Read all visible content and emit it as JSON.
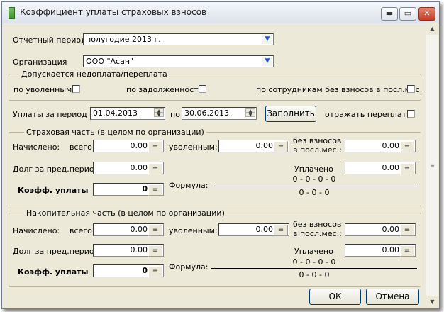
{
  "window": {
    "title": "Коэффициент уплаты страховых взносов",
    "buttons": {
      "minimize": "▬",
      "maximize": "▭",
      "close": "✕"
    }
  },
  "period": {
    "label": "Отчетный период",
    "value": "полугодие 2013 г."
  },
  "org": {
    "label": "Организация",
    "value": "ООО \"Асан\""
  },
  "allowed": {
    "title": "Допускается недоплата/переплата",
    "dismissed": "по уволенным",
    "debt": "по задолженности",
    "no_contrib": "по сотрудникам без взносов в посл.мес."
  },
  "payments": {
    "label": "Уплаты за период с",
    "from": "01.04.2013",
    "to_label": "по",
    "to": "30.06.2013",
    "fill_button": "Заполнить",
    "overpay_label": "отражать переплату"
  },
  "insurance": {
    "title": "Страховая часть (в целом по организации)",
    "accrued_label": "Начислено:",
    "total_label": "всего:",
    "total": "0.00",
    "dismissed_label": "уволенным:",
    "dismissed": "0.00",
    "no_contrib_label_1": "без взносов",
    "no_contrib_label_2": "в посл.мес.:",
    "no_contrib": "0.00",
    "debt_label": "Долг за пред.период:",
    "debt": "0.00",
    "paid_label": "Уплачено",
    "paid": "0.00",
    "coef_label": "Коэфф. уплаты",
    "coef": "0",
    "formula_label": "Формула:",
    "formula_num": "0 - 0 - 0 - 0",
    "formula_den": "0 - 0 - 0"
  },
  "funded": {
    "title": "Накопительная часть (в целом по организации)",
    "accrued_label": "Начислено:",
    "total_label": "всего:",
    "total": "0.00",
    "dismissed_label": "уволенным:",
    "dismissed": "0.00",
    "no_contrib_label_1": "без взносов",
    "no_contrib_label_2": "в посл.мес.:",
    "no_contrib": "0.00",
    "debt_label": "Долг за пред.период:",
    "debt": "0.00",
    "paid_label": "Уплачено",
    "paid": "0.00",
    "coef_label": "Коэфф. уплаты",
    "coef": "0",
    "formula_label": "Формула:",
    "formula_num": "0 - 0 - 0 - 0",
    "formula_den": "0 - 0 - 0"
  },
  "footer": {
    "ok": "ОК",
    "cancel": "Отмена"
  },
  "icons": {
    "dropdown": "dropdown-arrow-icon",
    "calc": "calculator-icon",
    "spin": "spin-arrows-icon",
    "scroll_up": "scroll-up-icon",
    "scroll_down": "scroll-down-icon"
  }
}
